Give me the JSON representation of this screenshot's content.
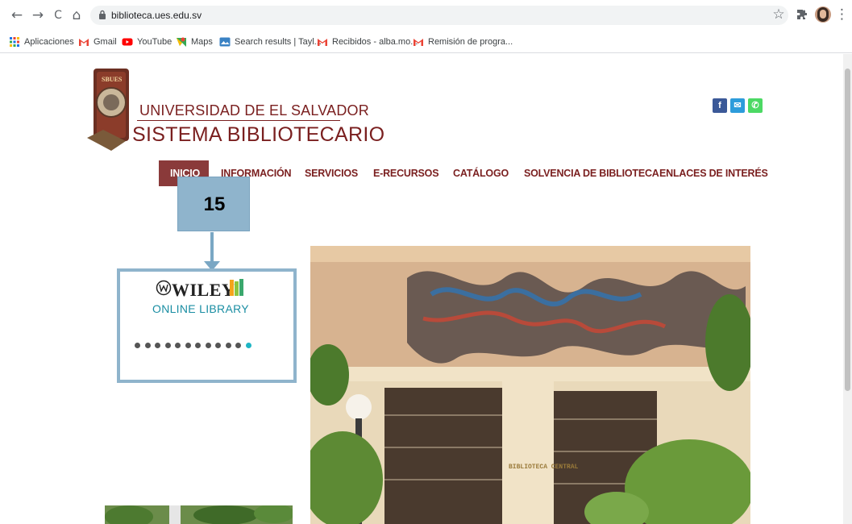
{
  "browser": {
    "url": "biblioteca.ues.edu.sv",
    "nav": {
      "back": "←",
      "forward": "→",
      "reload": "C",
      "home": "⌂"
    },
    "right": {
      "star": "☆",
      "extensions": "⋮"
    },
    "bookmarks": [
      {
        "label": "Aplicaciones",
        "icon": "apps-grid-icon"
      },
      {
        "label": "Gmail",
        "icon": "gmail-icon"
      },
      {
        "label": "YouTube",
        "icon": "youtube-icon"
      },
      {
        "label": "Maps",
        "icon": "maps-icon"
      },
      {
        "label": "Search results | Tayl...",
        "icon": "search-results-icon"
      },
      {
        "label": "Recibidos - alba.mo...",
        "icon": "gmail-icon"
      },
      {
        "label": "Remisión de progra...",
        "icon": "gmail-icon"
      }
    ]
  },
  "header": {
    "university": "UNIVERSIDAD DE EL SALVADOR",
    "system": "SISTEMA BIBLIOTECARIO",
    "logo_text": "SBUES",
    "social": [
      {
        "icon": "facebook-icon",
        "glyph": "f",
        "color": "#3b5998"
      },
      {
        "icon": "mail-icon",
        "glyph": "✉",
        "color": "#2d9cdb"
      },
      {
        "icon": "phone-icon",
        "glyph": "✆",
        "color": "#4cd964"
      }
    ]
  },
  "menu": [
    "INICIO",
    "INFORMACIÓN",
    "SERVICIOS",
    "E-RECURSOS",
    "CATÁLOGO",
    "SOLVENCIA DE BIBLIOTECA",
    "ENLACES DE INTERÉS"
  ],
  "annotation": {
    "number": "15"
  },
  "slider": {
    "logo": "WILEY",
    "subtitle": "ONLINE LIBRARY",
    "dots": 12,
    "active_dot": 12,
    "colors": {
      "dot": "#555555",
      "active": "#1fb5c4"
    }
  },
  "photo": {
    "building_sign": "BIBLIOTECA CENTRAL"
  }
}
